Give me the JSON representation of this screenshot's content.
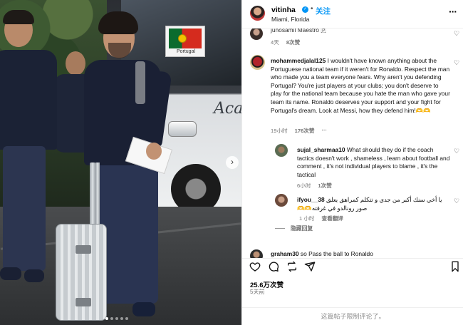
{
  "post": {
    "username": "vitinha",
    "verified_mark": "✓",
    "separator": "•",
    "follow_label": "关注",
    "location": "Miami, Florida",
    "more_icon": "more-horizontal-icon",
    "photo_flag_text": "Portugal",
    "photo_bus_logo": "Aca",
    "photo_next_glyph": "›"
  },
  "comments": [
    {
      "username": "",
      "text": "junosamil Maestro 🇵",
      "time": "4天",
      "likes": "8次赞"
    },
    {
      "username": "mohammedjalal125",
      "text": "I wouldn't have known anything about the Portuguese national team if it weren't for Ronaldo. Respect the man who made you a team everyone fears. Why aren't you defending Portugal? You're just players at your clubs; you don't deserve to play for the national team because you hate the man who gave your team its name. Ronaldo deserves your support and your fight for Portugal's dream. Look at Messi, how they defend him!🫶🫶",
      "time": "19小时",
      "likes": "176次赞",
      "more": "···"
    },
    {
      "username": "sujal_sharmaa10",
      "text": "What should they do if the coach tactics doesn't work , shameless , learn about football and comment , it's not individual players to blame , it's the tactical",
      "time": "6小时",
      "likes": "1次赞"
    },
    {
      "username": "ifyou__38",
      "text": "يا أخي سنك أكبر من جدي و تتكلم كمراهق يعلق صور رونالدو في غرفته🫶🫶",
      "time": "1 小时",
      "translate": "查看翻译"
    },
    {
      "username": "graham30",
      "text": "so Pass the ball to Ronaldo"
    }
  ],
  "hide_replies": "隐藏回复",
  "actions": {
    "likes": "25.6万次赞",
    "time_ago": "5天前",
    "comments_limited": "这篇帖子限制评论了。"
  },
  "colors": {
    "accent": "#0095f6",
    "muted": "#737373"
  }
}
